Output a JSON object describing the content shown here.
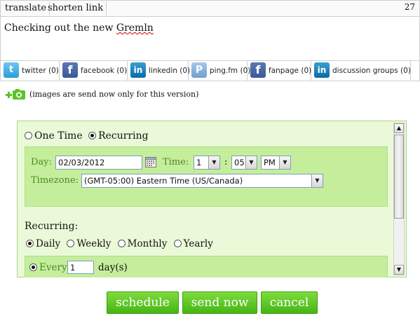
{
  "toolbar": {
    "translate": "translate",
    "shorten": "shorten link",
    "char_count": "27"
  },
  "compose": {
    "text_prefix": "Checking out the new ",
    "text_word": "Gremln"
  },
  "networks": [
    {
      "icon": "twitter-icon",
      "glyph": "t",
      "label": "twitter (0)"
    },
    {
      "icon": "facebook-icon",
      "glyph": "f",
      "label": "facebook (0)"
    },
    {
      "icon": "linkedin-icon",
      "glyph": "in",
      "label": "linkedin (0)"
    },
    {
      "icon": "pingfm-icon",
      "glyph": "P",
      "label": "ping.fm (0)"
    },
    {
      "icon": "facebook-icon",
      "glyph": "f",
      "label": "fanpage (0)"
    },
    {
      "icon": "linkedin-icon",
      "glyph": "in",
      "label": "discussion groups (0)"
    }
  ],
  "image_note": "(images are send now only for this version)",
  "schedule": {
    "one_time": "One Time",
    "recurring": "Recurring",
    "selected_mode": "recurring",
    "day_label": "Day:",
    "day_value": "02/03/2012",
    "time_label": "Time:",
    "hour": "1",
    "colon": ":",
    "minute": "05",
    "ampm": "PM",
    "timezone_label": "Timezone:",
    "timezone_value": "(GMT-05:00) Eastern Time (US/Canada)",
    "recurring_label": "Recurring:",
    "freq": [
      "Daily",
      "Weekly",
      "Monthly",
      "Yearly"
    ],
    "selected_freq": "Daily",
    "every_label": "Every",
    "every_value": "1",
    "every_unit": "day(s)"
  },
  "actions": {
    "schedule": "schedule",
    "send_now": "send now",
    "cancel": "cancel"
  },
  "colors": {
    "accent": "#45b514",
    "panel": "#eaf9d8",
    "inner": "#c5ee9c"
  }
}
